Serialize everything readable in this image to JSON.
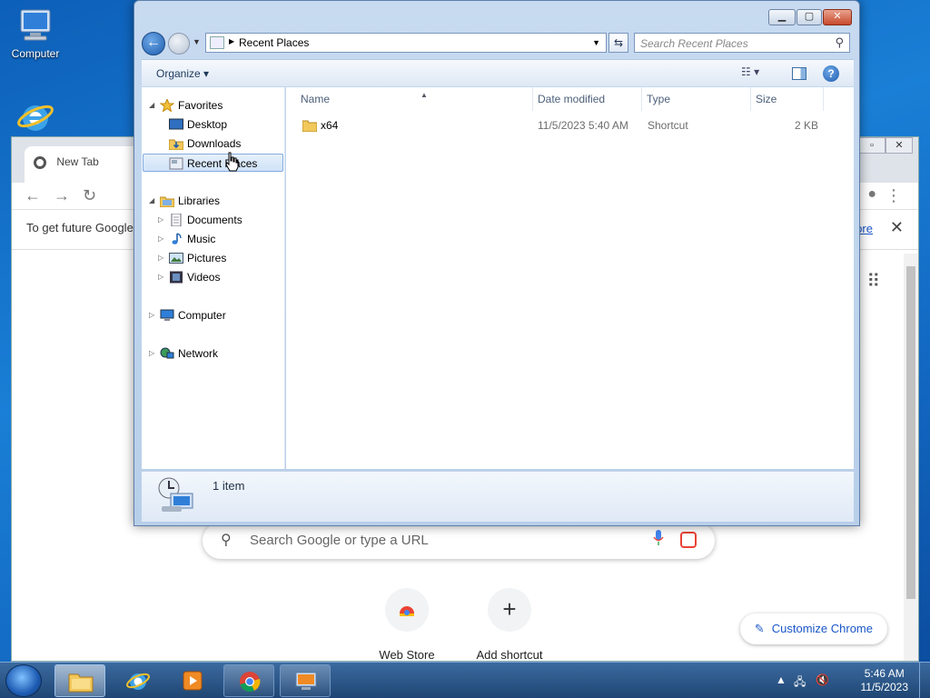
{
  "desktop": {
    "icons": [
      {
        "label": "Computer"
      },
      {
        "label": "Internet Explorer"
      }
    ]
  },
  "chrome": {
    "tab_title": "New Tab",
    "infobar_text": "To get future Google",
    "infobar_link": "ore",
    "search_placeholder": "Search Google or type a URL",
    "shortcuts": [
      {
        "label": "Web Store"
      },
      {
        "label": "Add shortcut",
        "glyph": "+"
      }
    ],
    "customize_label": "Customize Chrome"
  },
  "explorer": {
    "address_path": "Recent Places",
    "search_placeholder": "Search Recent Places",
    "organize_label": "Organize",
    "nav": {
      "favorites": "Favorites",
      "desktop": "Desktop",
      "downloads": "Downloads",
      "recent_places": "Recent Places",
      "libraries": "Libraries",
      "documents": "Documents",
      "music": "Music",
      "pictures": "Pictures",
      "videos": "Videos",
      "computer": "Computer",
      "network": "Network"
    },
    "columns": {
      "name": "Name",
      "date_modified": "Date modified",
      "type": "Type",
      "size": "Size"
    },
    "files": [
      {
        "name": "x64",
        "date_modified": "11/5/2023 5:40 AM",
        "type": "Shortcut",
        "size": "2 KB"
      }
    ],
    "item_count": "1 item"
  },
  "taskbar": {
    "time": "5:46 AM",
    "date": "11/5/2023"
  },
  "colors": {
    "desktop_blue": "#1a7fd6",
    "selection_border": "#84acdd",
    "link_blue": "#1a57c8"
  }
}
